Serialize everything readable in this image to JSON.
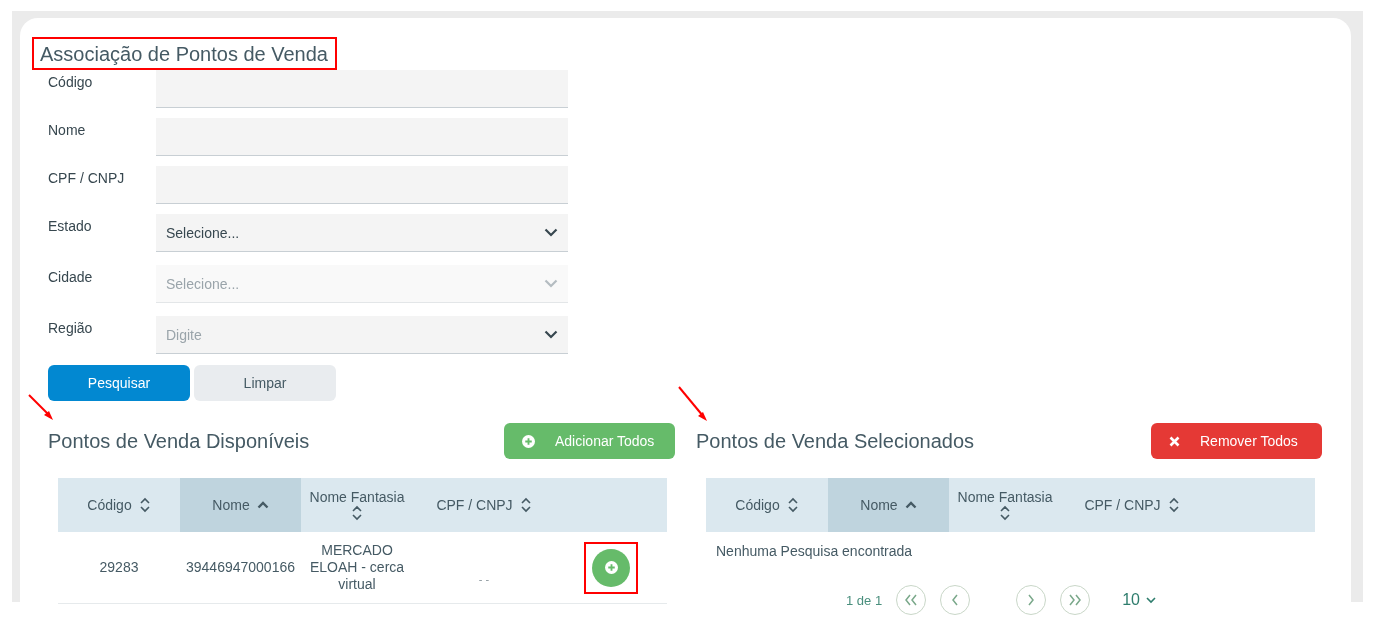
{
  "title": "Associação de Pontos de Venda",
  "form": {
    "fields": [
      {
        "label": "Código",
        "kind": "text",
        "disabled": false
      },
      {
        "label": "Nome",
        "kind": "text",
        "disabled": false
      },
      {
        "label": "CPF / CNPJ",
        "kind": "text",
        "disabled": false
      },
      {
        "label": "Estado",
        "kind": "select",
        "value": "Selecione...",
        "disabled": false
      },
      {
        "label": "Cidade",
        "kind": "select",
        "placeholder": "Selecione...",
        "disabled": true
      },
      {
        "label": "Região",
        "kind": "select",
        "placeholder": "Digite",
        "disabled": false
      }
    ],
    "buttons": [
      {
        "label": "Pesquisar",
        "kind": "primary"
      },
      {
        "label": "Limpar",
        "kind": "secondary"
      }
    ]
  },
  "panels": [
    {
      "title": "Pontos de Venda Disponíveis",
      "action": {
        "label": "Adicionar Todos",
        "kind": "add"
      },
      "columns": [
        {
          "label": "Código",
          "selected": false
        },
        {
          "label": "Nome",
          "selected": true
        },
        {
          "label": "Nome Fantasia",
          "selected": false
        },
        {
          "label": "CPF / CNPJ",
          "selected": false
        }
      ],
      "rows": [
        {
          "cells": [
            "29283",
            "39446947000166",
            "MERCADO ELOAH - cerca virtual",
            "- -"
          ]
        }
      ]
    },
    {
      "title": "Pontos de Venda Selecionados",
      "action": {
        "label": "Remover Todos",
        "kind": "remove"
      },
      "columns": [
        {
          "label": "Código",
          "selected": false
        },
        {
          "label": "Nome",
          "selected": true
        },
        {
          "label": "Nome Fantasia",
          "selected": false
        },
        {
          "label": "CPF / CNPJ",
          "selected": false
        }
      ],
      "empty_message": "Nenhuma Pesquisa encontrada",
      "pagination": {
        "status": "1 de 1",
        "page_size": "10"
      }
    }
  ]
}
